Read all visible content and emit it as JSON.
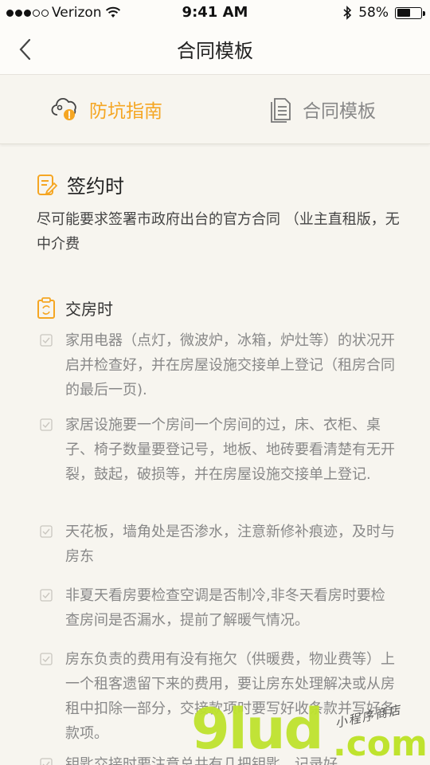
{
  "status_bar": {
    "carrier": "Verizon",
    "time": "9:41 AM",
    "battery": "58%",
    "battery_level": 0.58
  },
  "nav": {
    "title": "合同模板",
    "back_icon": "chevron-left-icon"
  },
  "tabs": [
    {
      "label": "防坑指南",
      "icon": "warning-cloud-icon",
      "active": true
    },
    {
      "label": "合同模板",
      "icon": "document-icon",
      "active": false
    }
  ],
  "sign": {
    "title": "签约时",
    "icon": "edit-note-icon",
    "text": "尽可能要求签署市政府出台的官方合同 （业主直租版，无中介费"
  },
  "handover": {
    "title": "交房时",
    "icon": "clipboard-icon",
    "items": [
      "家用电器（点灯，微波炉，冰箱，炉灶等）的状况开启并检查好，并在房屋设施交接单上登记（租房合同的最后一页).",
      "家居设施要一个房间一个房间的过，床、衣柜、桌子、椅子数量要登记号，地板、地砖要看清楚有无开裂，鼓起，破损等，并在房屋设施交接单上登记.",
      "天花板，墙角处是否渗水，注意新修补痕迹，及时与房东",
      "非夏天看房要检查空调是否制冷,非冬天看房时要检查房间是否漏水，提前了解暖气情况。",
      "房东负责的费用有没有拖欠（供暖费，物业费等）上一个租客遗留下来的费用，要让房东处理解决或从房租中扣除一部分，交接款项时要写好收条款并写好各款项。",
      "钥匙交接时要注意总共有几把钥匙，记录好"
    ]
  },
  "watermark": {
    "brand": "9lud",
    "suffix": ".com",
    "tagline": "小程序商店"
  },
  "colors": {
    "accent": "#f5a623",
    "muted": "#888888",
    "background": "#f7f5ef",
    "watermark": "#bfe32e"
  }
}
